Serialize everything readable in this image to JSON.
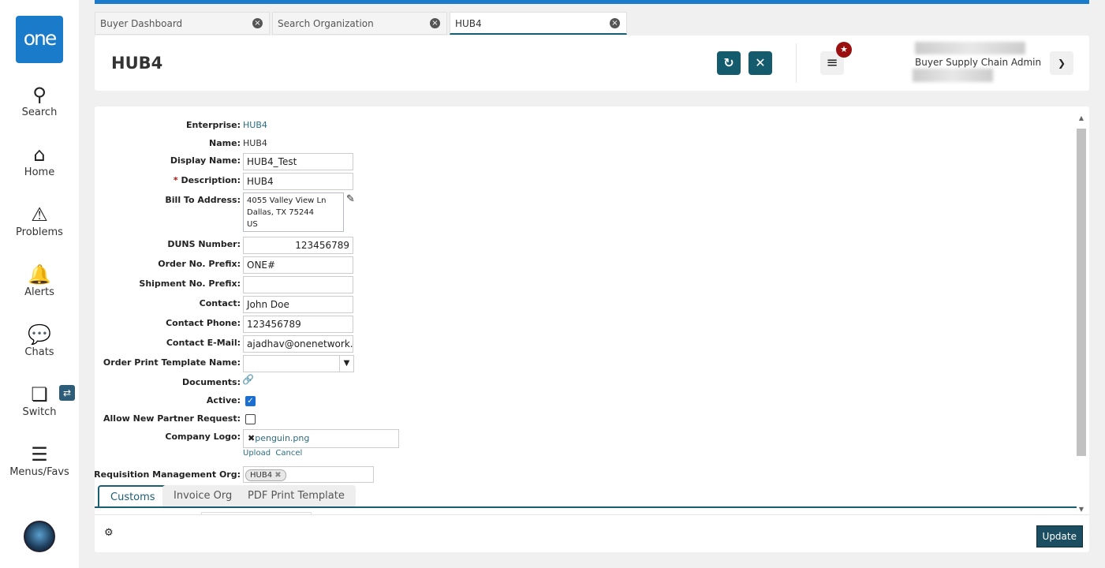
{
  "sidebar": {
    "logo": "one",
    "items": [
      {
        "label": "Search",
        "icon": "search-icon"
      },
      {
        "label": "Home",
        "icon": "home-icon"
      },
      {
        "label": "Problems",
        "icon": "warning-icon"
      },
      {
        "label": "Alerts",
        "icon": "bell-icon"
      },
      {
        "label": "Chats",
        "icon": "chat-icon"
      },
      {
        "label": "Switch",
        "icon": "switch-icon"
      },
      {
        "label": "Menus/Favs",
        "icon": "menu-icon"
      }
    ]
  },
  "tabs": [
    {
      "label": "Buyer Dashboard"
    },
    {
      "label": "Search Organization"
    },
    {
      "label": "HUB4"
    }
  ],
  "header": {
    "title": "HUB4",
    "role": "Buyer Supply Chain Admin"
  },
  "form": {
    "enterprise_label": "Enterprise:",
    "enterprise": "HUB4",
    "name_label": "Name:",
    "name": "HUB4",
    "display_name_label": "Display Name:",
    "display_name": "HUB4_Test",
    "description_req": "*",
    "description_label": "Description:",
    "description": "HUB4",
    "bill_to_label": "Bill To Address:",
    "bill_to": [
      "4055 Valley View Ln",
      "Dallas, TX 75244",
      "US"
    ],
    "duns_label": "DUNS Number:",
    "duns": "123456789",
    "order_prefix_label": "Order No. Prefix:",
    "order_prefix": "ONE#",
    "shipment_prefix_label": "Shipment No. Prefix:",
    "shipment_prefix": "",
    "contact_label": "Contact:",
    "contact": "John Doe",
    "phone_label": "Contact Phone:",
    "phone": "123456789",
    "email_label": "Contact E-Mail:",
    "email": "ajadhav@onenetwork.c",
    "print_template_label": "Order Print Template Name:",
    "print_template": "",
    "documents_label": "Documents:",
    "active_label": "Active:",
    "active": true,
    "allow_partner_label": "Allow New Partner Request:",
    "allow_partner": false,
    "logo_label": "Company Logo:",
    "logo_file": "penguin.png",
    "upload": "Upload",
    "cancel": "Cancel",
    "req_org_label": "Requisition Management Org:",
    "req_org_tag": "HUB4"
  },
  "bottom_tabs": [
    {
      "label": "Customs"
    },
    {
      "label": "Invoice Org"
    },
    {
      "label": "PDF Print Template"
    }
  ],
  "footer": {
    "update": "Update"
  }
}
